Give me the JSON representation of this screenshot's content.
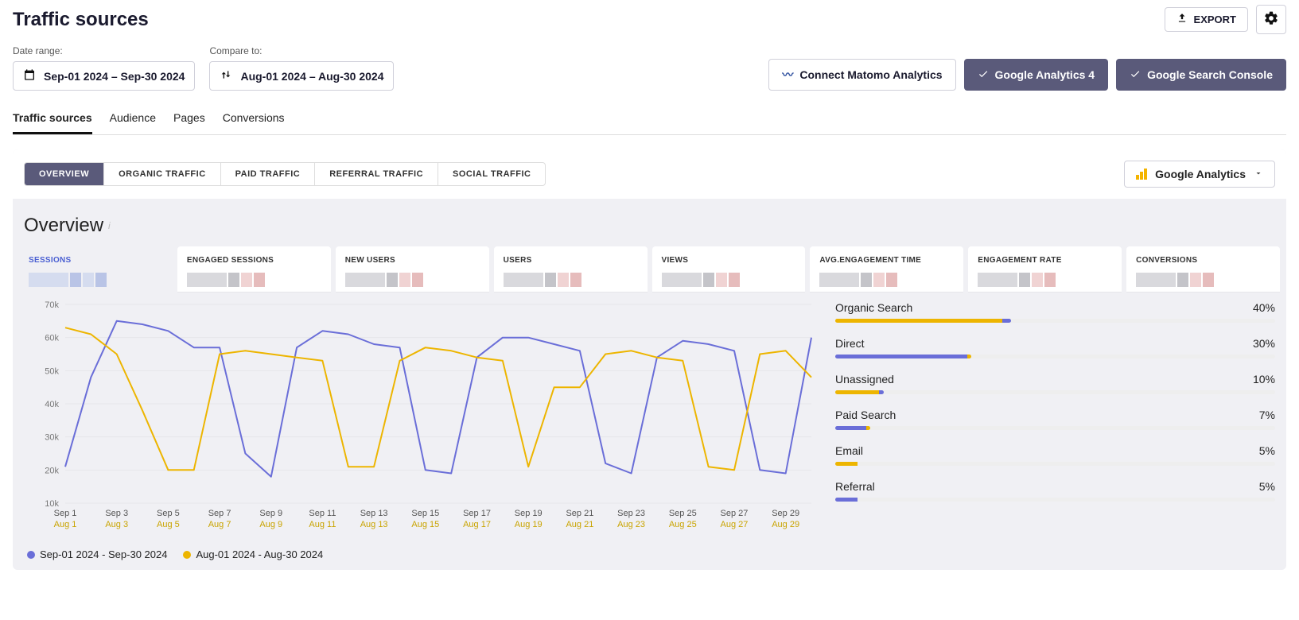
{
  "colors": {
    "purple": "#6a6ed8",
    "yellow": "#edb500",
    "darkbtn": "#5a5a7a",
    "accent": "#4a5fd2"
  },
  "header": {
    "title": "Traffic sources",
    "export_label": "EXPORT"
  },
  "filters": {
    "date_range_label": "Date range:",
    "compare_to_label": "Compare to:",
    "date_range_value": "Sep-01 2024 – Sep-30 2024",
    "compare_to_value": "Aug-01 2024 – Aug-30 2024"
  },
  "integrations": {
    "matomo_label": "Connect Matomo Analytics",
    "ga4_label": "Google Analytics 4",
    "gsc_label": "Google Search Console"
  },
  "main_tabs": [
    {
      "label": "Traffic sources",
      "active": true
    },
    {
      "label": "Audience",
      "active": false
    },
    {
      "label": "Pages",
      "active": false
    },
    {
      "label": "Conversions",
      "active": false
    }
  ],
  "sub_tabs": [
    {
      "label": "OVERVIEW",
      "active": true
    },
    {
      "label": "ORGANIC TRAFFIC",
      "active": false
    },
    {
      "label": "PAID TRAFFIC",
      "active": false
    },
    {
      "label": "REFERRAL TRAFFIC",
      "active": false
    },
    {
      "label": "SOCIAL TRAFFIC",
      "active": false
    }
  ],
  "source_selector": {
    "label": "Google Analytics"
  },
  "overview": {
    "title": "Overview",
    "metric_tabs": [
      {
        "label": "SESSIONS",
        "active": true
      },
      {
        "label": "ENGAGED SESSIONS",
        "active": false
      },
      {
        "label": "NEW USERS",
        "active": false
      },
      {
        "label": "USERS",
        "active": false
      },
      {
        "label": "VIEWS",
        "active": false
      },
      {
        "label": "AVG.ENGAGEMENT TIME",
        "active": false
      },
      {
        "label": "ENGAGEMENT RATE",
        "active": false
      },
      {
        "label": "CONVERSIONS",
        "active": false
      }
    ]
  },
  "chart_data": {
    "type": "line",
    "ylabel": "",
    "xlabel": "",
    "ylim": [
      10000,
      70000
    ],
    "y_ticks": [
      "10k",
      "20k",
      "30k",
      "40k",
      "50k",
      "60k",
      "70k"
    ],
    "x_labels_primary": [
      "Sep 1",
      "Sep 3",
      "Sep 5",
      "Sep 7",
      "Sep 9",
      "Sep 11",
      "Sep 13",
      "Sep 15",
      "Sep 17",
      "Sep 19",
      "Sep 21",
      "Sep 23",
      "Sep 25",
      "Sep 27",
      "Sep 29"
    ],
    "x_labels_compare": [
      "Aug 1",
      "Aug 3",
      "Aug 5",
      "Aug 7",
      "Aug 9",
      "Aug 11",
      "Aug 13",
      "Aug 15",
      "Aug 17",
      "Aug 19",
      "Aug 21",
      "Aug 23",
      "Aug 25",
      "Aug 27",
      "Aug 29"
    ],
    "series": [
      {
        "name": "Sep-01 2024 - Sep-30 2024",
        "color": "#6a6ed8",
        "values": [
          21000,
          48000,
          65000,
          64000,
          62000,
          57000,
          57000,
          25000,
          18000,
          57000,
          62000,
          61000,
          58000,
          57000,
          20000,
          19000,
          54000,
          60000,
          60000,
          58000,
          56000,
          22000,
          19000,
          54000,
          59000,
          58000,
          56000,
          20000,
          19000,
          60000
        ]
      },
      {
        "name": "Aug-01 2024 - Aug-30 2024",
        "color": "#edb500",
        "values": [
          63000,
          61000,
          55000,
          38000,
          20000,
          20000,
          55000,
          56000,
          55000,
          54000,
          53000,
          21000,
          21000,
          53000,
          57000,
          56000,
          54000,
          53000,
          21000,
          45000,
          45000,
          55000,
          56000,
          54000,
          53000,
          21000,
          20000,
          55000,
          56000,
          48000
        ]
      }
    ]
  },
  "legend": {
    "series_a": "Sep-01 2024 - Sep-30 2024",
    "series_b": "Aug-01 2024 - Aug-30 2024"
  },
  "traffic_breakdown": [
    {
      "label": "Organic Search",
      "pct": "40%",
      "bar_a": 38,
      "bar_b": 2
    },
    {
      "label": "Direct",
      "pct": "30%",
      "bar_a": 30,
      "bar_b": 1
    },
    {
      "label": "Unassigned",
      "pct": "10%",
      "bar_a": 10,
      "bar_b": 1
    },
    {
      "label": "Paid Search",
      "pct": "7%",
      "bar_a": 7,
      "bar_b": 1
    },
    {
      "label": "Email",
      "pct": "5%",
      "bar_a": 5,
      "bar_b": 0
    },
    {
      "label": "Referral",
      "pct": "5%",
      "bar_a": 5,
      "bar_b": 0
    }
  ]
}
